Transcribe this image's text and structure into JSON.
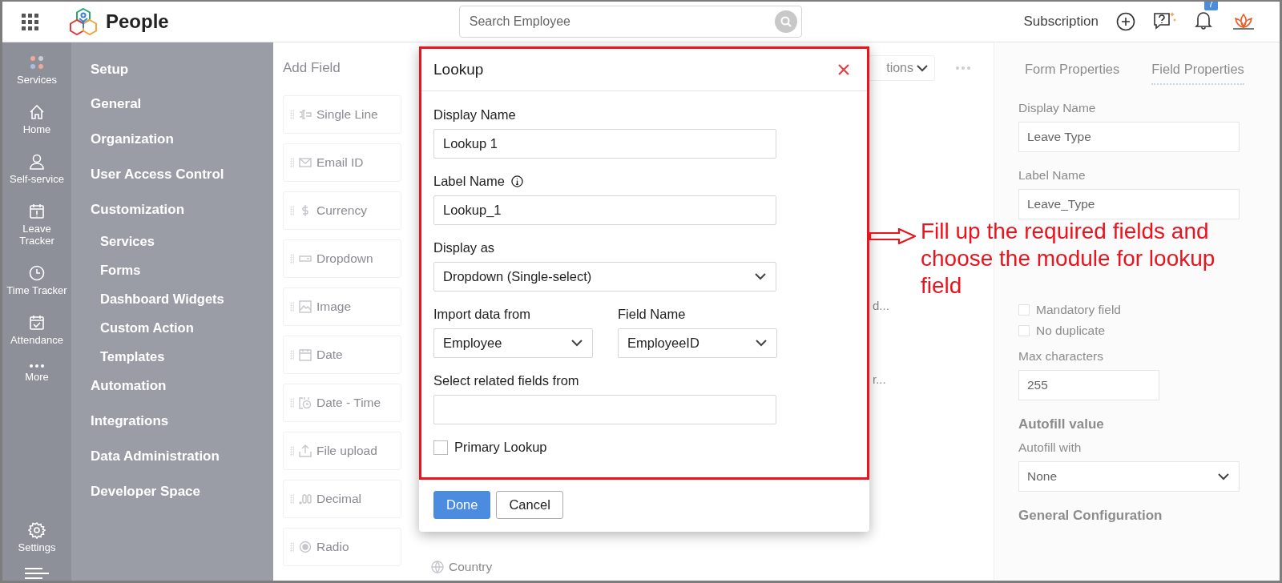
{
  "topbar": {
    "app_name": "People",
    "search": {
      "placeholder": "Search Employee"
    },
    "subscription": "Subscription",
    "notification_count": "7"
  },
  "rail": [
    {
      "label": "Services",
      "kind": "services"
    },
    {
      "label": "Home",
      "kind": "home"
    },
    {
      "label": "Self-service",
      "kind": "person"
    },
    {
      "label": "Leave Tracker",
      "kind": "leave"
    },
    {
      "label": "Time Tracker",
      "kind": "clock"
    },
    {
      "label": "Attendance",
      "kind": "attendance"
    },
    {
      "label": "More",
      "kind": "more"
    },
    {
      "label": "Settings",
      "kind": "settings"
    }
  ],
  "setup_menu": {
    "title": "Setup",
    "items": [
      {
        "label": "General"
      },
      {
        "label": "Organization"
      },
      {
        "label": "User Access Control"
      },
      {
        "label": "Customization",
        "children": [
          {
            "label": "Services"
          },
          {
            "label": "Forms"
          },
          {
            "label": "Dashboard Widgets"
          },
          {
            "label": "Custom Action"
          },
          {
            "label": "Templates"
          }
        ]
      },
      {
        "label": "Automation"
      },
      {
        "label": "Integrations"
      },
      {
        "label": "Data Administration"
      },
      {
        "label": "Developer Space"
      }
    ]
  },
  "add_field": {
    "title": "Add Field",
    "items": [
      {
        "label": "Single Line",
        "kind": "single_line"
      },
      {
        "label": "Email ID",
        "kind": "email"
      },
      {
        "label": "Currency",
        "kind": "currency"
      },
      {
        "label": "Dropdown",
        "kind": "dropdown"
      },
      {
        "label": "Image",
        "kind": "image"
      },
      {
        "label": "Date",
        "kind": "date"
      },
      {
        "label": "Date - Time",
        "kind": "datetime"
      },
      {
        "label": "File upload",
        "kind": "upload"
      },
      {
        "label": "Decimal",
        "kind": "decimal"
      },
      {
        "label": "Radio",
        "kind": "radio"
      }
    ],
    "second_column": [
      {
        "label": "Country",
        "kind": "country"
      }
    ]
  },
  "canvas": {
    "options_button": "tions",
    "fragments": [
      "d...",
      "r..."
    ]
  },
  "modal": {
    "title": "Lookup",
    "display_name": {
      "label": "Display Name",
      "value": "Lookup 1"
    },
    "label_name": {
      "label": "Label Name",
      "value": "Lookup_1"
    },
    "display_as": {
      "label": "Display as",
      "value": "Dropdown (Single-select)"
    },
    "import_from": {
      "label": "Import data from",
      "value": "Employee"
    },
    "field_name": {
      "label": "Field Name",
      "value": "EmployeeID"
    },
    "related_fields": {
      "label": "Select related fields from"
    },
    "primary_lookup": {
      "label": "Primary Lookup",
      "checked": false
    },
    "buttons": [
      {
        "label": "Done",
        "kind": "primary"
      },
      {
        "label": "Cancel",
        "kind": "secondary"
      }
    ]
  },
  "right_panel": {
    "tabs": [
      {
        "label": "Form Properties",
        "selected": false
      },
      {
        "label": "Field Properties",
        "selected": true
      }
    ],
    "display_name": {
      "label": "Display Name",
      "value": "Leave Type"
    },
    "label_name": {
      "label": "Label Name",
      "value": "Leave_Type"
    },
    "checkboxes": [
      {
        "label": "Mandatory field",
        "checked": false
      },
      {
        "label": "No duplicate",
        "checked": false
      }
    ],
    "max_characters": {
      "label": "Max characters",
      "value": "255"
    },
    "autofill_title": "Autofill value",
    "autofill_with": {
      "label": "Autofill with",
      "value": "None"
    },
    "general_title": "General Configuration"
  },
  "annotation": {
    "text": "Fill up the required fields and choose the module for lookup field"
  }
}
